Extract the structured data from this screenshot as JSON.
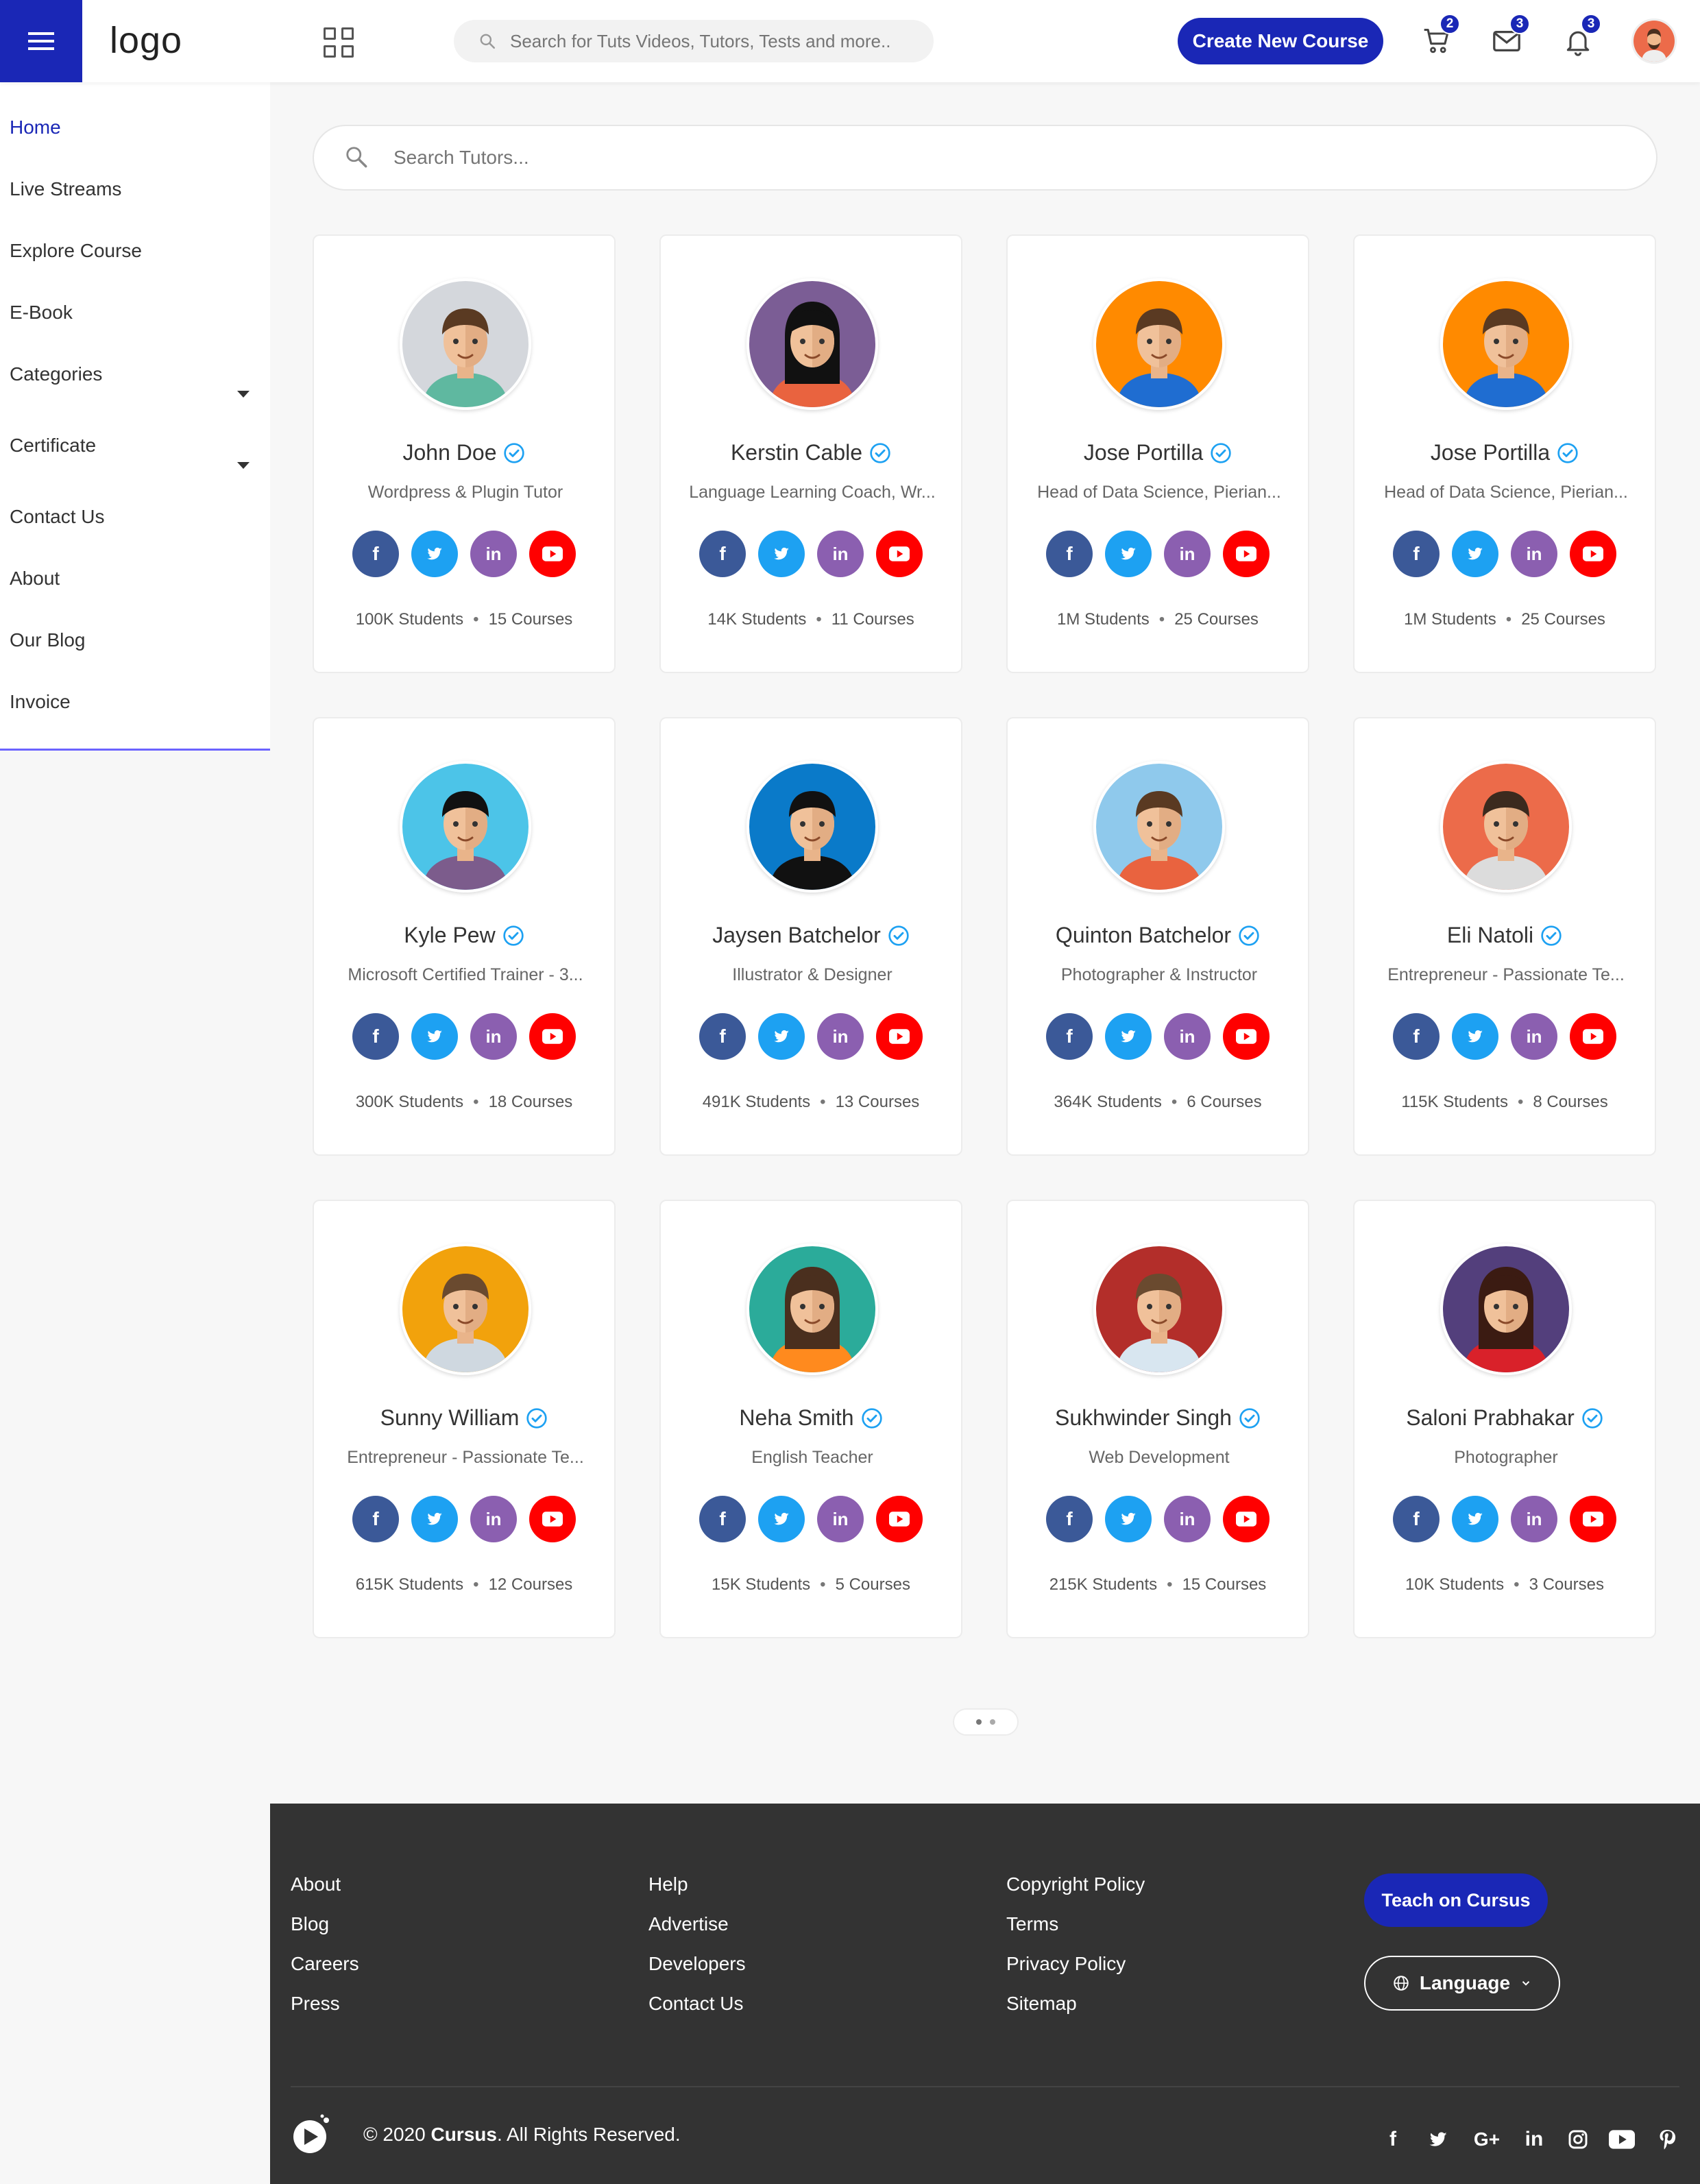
{
  "header": {
    "logo": "logo",
    "search_placeholder": "Search for Tuts Videos, Tutors, Tests and more..",
    "create_button": "Create New Course",
    "cart_count": "2",
    "messages_count": "3",
    "notifications_count": "3"
  },
  "sidebar": {
    "items": [
      {
        "label": "Home"
      },
      {
        "label": "Live Streams"
      },
      {
        "label": "Explore Course"
      },
      {
        "label": "E-Book"
      },
      {
        "label": "Categories"
      },
      {
        "label": "Certificate"
      },
      {
        "label": "Contact Us"
      },
      {
        "label": "About"
      },
      {
        "label": "Our Blog"
      },
      {
        "label": "Invoice"
      }
    ]
  },
  "main": {
    "search_placeholder": "Search Tutors...",
    "tutors": [
      {
        "name": "John Doe",
        "role": "Wordpress & Plugin Tutor",
        "students": "100K Students",
        "courses": "15 Courses",
        "avatar_bg": "#d4d7dc"
      },
      {
        "name": "Kerstin Cable",
        "role": "Language Learning Coach, Wr...",
        "students": "14K Students",
        "courses": "11 Courses",
        "avatar_bg": "#7b5d95"
      },
      {
        "name": "Jose Portilla",
        "role": "Head of Data Science, Pierian...",
        "students": "1M Students",
        "courses": "25 Courses",
        "avatar_bg": "#ff8a00"
      },
      {
        "name": "Jose Portilla",
        "role": "Head of Data Science, Pierian...",
        "students": "1M Students",
        "courses": "25 Courses",
        "avatar_bg": "#ff8a00"
      },
      {
        "name": "Kyle Pew",
        "role": "Microsoft Certified Trainer - 3...",
        "students": "300K Students",
        "courses": "18 Courses",
        "avatar_bg": "#4cc4e8"
      },
      {
        "name": "Jaysen Batchelor",
        "role": "Illustrator & Designer",
        "students": "491K Students",
        "courses": "13 Courses",
        "avatar_bg": "#0a7ac9"
      },
      {
        "name": "Quinton Batchelor",
        "role": "Photographer & Instructor",
        "students": "364K Students",
        "courses": "6 Courses",
        "avatar_bg": "#8fc9ec"
      },
      {
        "name": "Eli Natoli",
        "role": "Entrepreneur - Passionate Te...",
        "students": "115K Students",
        "courses": "8 Courses",
        "avatar_bg": "#ec6b4a"
      },
      {
        "name": "Sunny William",
        "role": "Entrepreneur - Passionate Te...",
        "students": "615K Students",
        "courses": "12 Courses",
        "avatar_bg": "#f2a20c"
      },
      {
        "name": "Neha Smith",
        "role": "English Teacher",
        "students": "15K Students",
        "courses": "5 Courses",
        "avatar_bg": "#2bab9a"
      },
      {
        "name": "Sukhwinder Singh",
        "role": "Web Development",
        "students": "215K Students",
        "courses": "15 Courses",
        "avatar_bg": "#b32e2a"
      },
      {
        "name": "Saloni Prabhakar",
        "role": "Photographer",
        "students": "10K Students",
        "courses": "3 Courses",
        "avatar_bg": "#533f7c"
      }
    ]
  },
  "footer": {
    "col1": [
      "About",
      "Blog",
      "Careers",
      "Press"
    ],
    "col2": [
      "Help",
      "Advertise",
      "Developers",
      "Contact Us"
    ],
    "col3": [
      "Copyright Policy",
      "Terms",
      "Privacy Policy",
      "Sitemap"
    ],
    "teach_button": "Teach on Cursus",
    "language_button": "Language",
    "copyright_prefix": "© 2020 ",
    "brand": "Cursus",
    "copyright_suffix": ". All Rights Reserved."
  },
  "colors": {
    "accent": "#1a27b6",
    "facebook": "#3b5998",
    "twitter": "#1da1f2",
    "linkedin": "#8b5fb0",
    "youtube": "#ff0000",
    "footer_bg": "#333333"
  }
}
